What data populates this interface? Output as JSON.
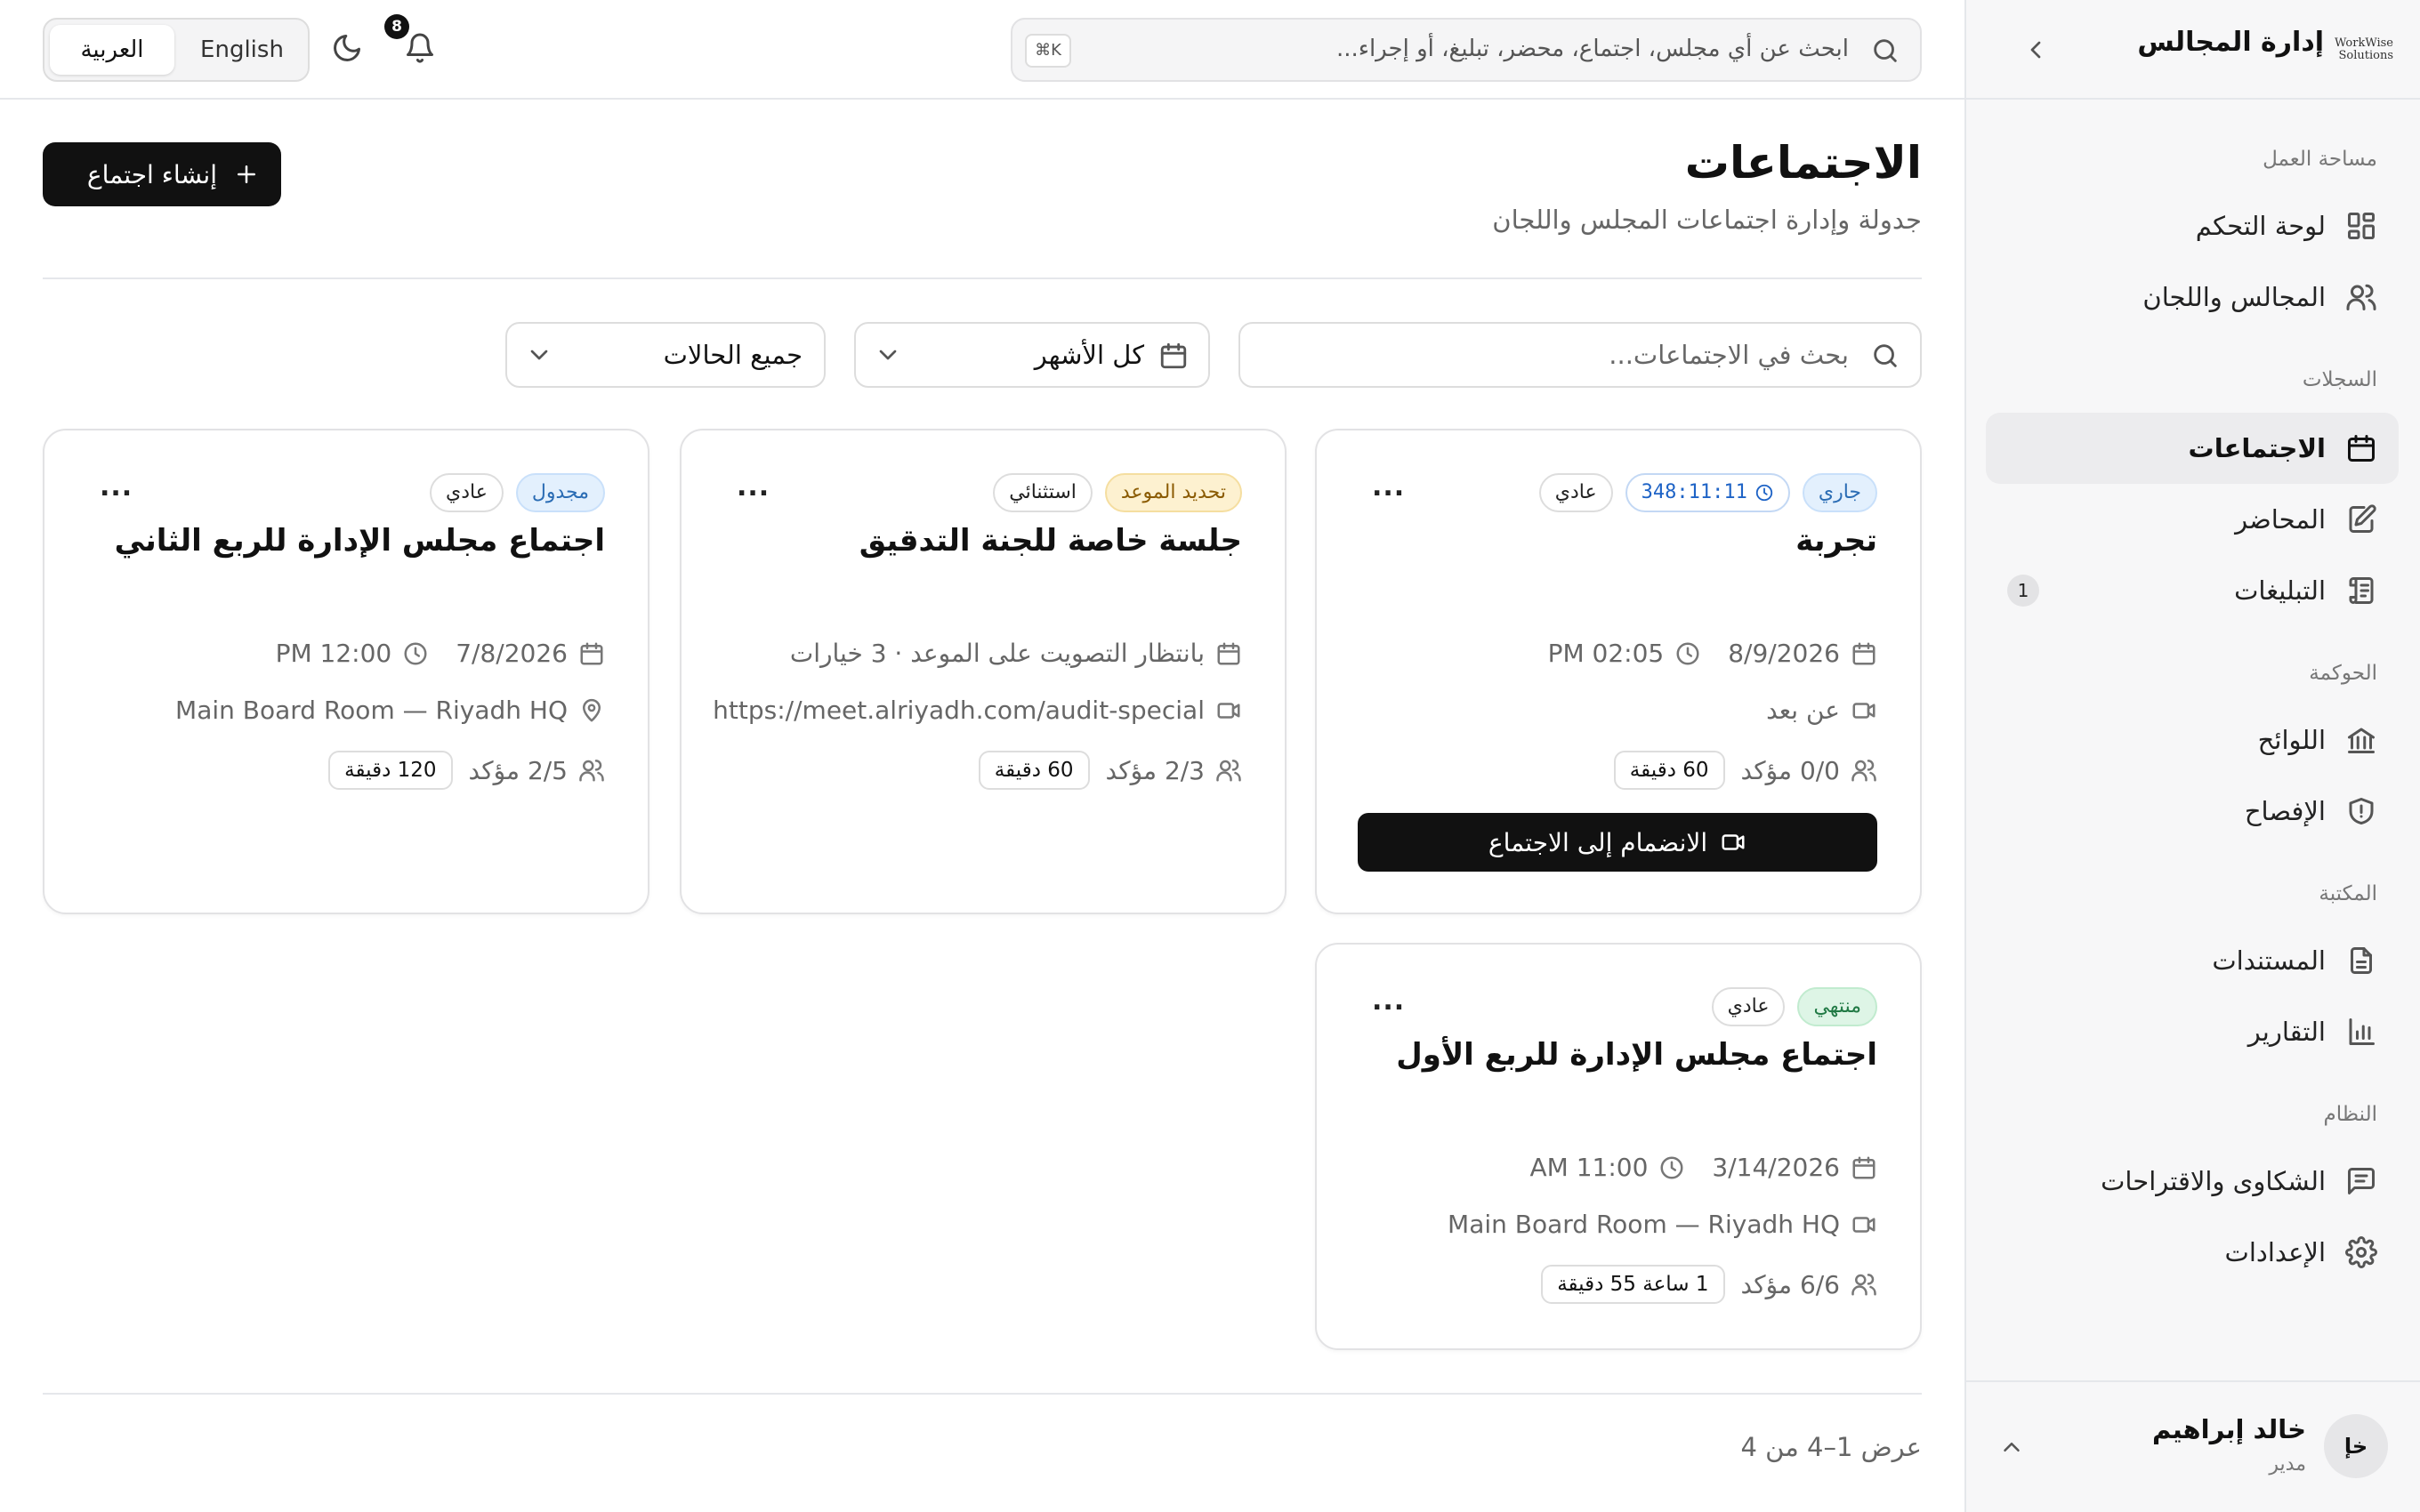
{
  "sidebar": {
    "logo_text": "WorkWise Solutions",
    "app_title": "إدارة المجالس",
    "sections": {
      "workspace": "مساحة العمل",
      "records": "السجلات",
      "governance": "الحوكمة",
      "library": "المكتبة",
      "system": "النظام"
    },
    "items": {
      "dashboard": "لوحة التحكم",
      "boards": "المجالس واللجان",
      "meetings": "الاجتماعات",
      "minutes": "المحاضر",
      "notices": "التبليغات",
      "notices_count": "1",
      "regulations": "اللوائح",
      "disclosure": "الإفصاح",
      "documents": "المستندات",
      "reports": "التقارير",
      "complaints": "الشكاوى والاقتراحات",
      "settings": "الإعدادات"
    },
    "user": {
      "initials": "خإ",
      "name": "خالد إبراهيم",
      "role": "مدير"
    }
  },
  "topbar": {
    "search_placeholder": "ابحث عن أي مجلس، اجتماع، محضر، تبليغ، أو إجراء...",
    "shortcut": "⌘K",
    "notif_count": "8",
    "lang_ar": "العربية",
    "lang_en": "English"
  },
  "page": {
    "title": "الاجتماعات",
    "subtitle": "جدولة وإدارة اجتماعات المجلس واللجان",
    "create_label": "إنشاء اجتماع",
    "filters": {
      "search_placeholder": "بحث في الاجتماعات...",
      "month": "كل الأشهر",
      "status": "جميع الحالات"
    },
    "pagination": "عرض 1–4 من 4"
  },
  "meetings": [
    {
      "title": "تجربة",
      "status": "جاري",
      "timer": "348:11:11",
      "type": "عادي",
      "date": "8/9/2026",
      "time": "PM 02:05",
      "location": "عن بعد",
      "attendance": "0/0 مؤكد",
      "duration": "60 دقيقة",
      "join_label": "الانضمام إلى الاجتماع"
    },
    {
      "title": "جلسة خاصة للجنة التدقيق",
      "status": "تحديد الموعد",
      "type": "استثنائي",
      "date": "بانتظار التصويت على الموعد · 3 خيارات",
      "location": "https://meet.alriyadh.com/audit-special",
      "attendance": "2/3 مؤكد",
      "duration": "60 دقيقة"
    },
    {
      "title": "اجتماع مجلس الإدارة للربع الثاني",
      "status": "مجدول",
      "type": "عادي",
      "date": "7/8/2026",
      "time": "PM 12:00",
      "location": "Main Board Room — Riyadh HQ",
      "attendance": "2/5 مؤكد",
      "duration": "120 دقيقة"
    },
    {
      "title": "اجتماع مجلس الإدارة للربع الأول",
      "status": "منتهي",
      "type": "عادي",
      "date": "3/14/2026",
      "time": "AM 11:00",
      "location": "Main Board Room — Riyadh HQ",
      "attendance": "6/6 مؤكد",
      "duration": "1 ساعة 55 دقيقة"
    }
  ],
  "more_label": "...",
  "colors": {
    "accent": "#111111",
    "status_live": "#2a6cb4",
    "status_pending": "#8a5a00",
    "status_done": "#217a45"
  }
}
